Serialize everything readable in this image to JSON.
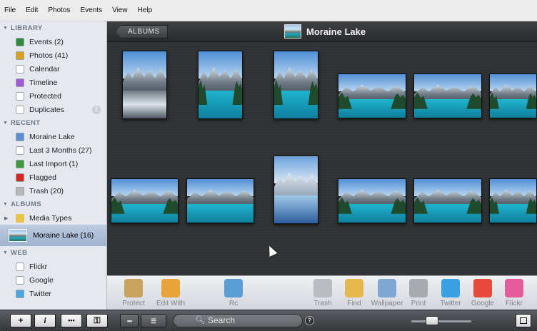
{
  "menu": [
    "File",
    "Edit",
    "Photos",
    "Events",
    "View",
    "Help"
  ],
  "sidebar": {
    "library_header": "LIBRARY",
    "library": [
      {
        "label": "Events (2)",
        "icon": "events-icon",
        "color": "#2f8a3a"
      },
      {
        "label": "Photos (41)",
        "icon": "photos-icon",
        "color": "#d9a21b"
      },
      {
        "label": "Calendar",
        "icon": "calendar-icon",
        "color": "#ffffff"
      },
      {
        "label": "Timeline",
        "icon": "timeline-icon",
        "color": "#a45ad6"
      },
      {
        "label": "Protected",
        "icon": "protected-icon",
        "color": "#ffffff"
      },
      {
        "label": "Duplicates",
        "icon": "duplicates-icon",
        "color": "#ffffff",
        "badge": "2"
      }
    ],
    "recent_header": "RECENT",
    "recent": [
      {
        "label": "Moraine Lake",
        "icon": "album-icon",
        "color": "#5b8fd1"
      },
      {
        "label": "Last 3 Months (27)",
        "icon": "clock-icon",
        "color": "#ffffff"
      },
      {
        "label": "Last Import (1)",
        "icon": "import-icon",
        "color": "#3b9a3b"
      },
      {
        "label": "Flagged",
        "icon": "flag-icon",
        "color": "#d6281e"
      },
      {
        "label": "Trash (20)",
        "icon": "trash-icon",
        "color": "#b8b8b8"
      }
    ],
    "albums_header": "ALBUMS",
    "albums": [
      {
        "label": "Media Types",
        "icon": "folder-icon",
        "color": "#e8c44b"
      }
    ],
    "selected_album": "Moraine Lake (16)",
    "web_header": "WEB",
    "web": [
      {
        "label": "Flickr",
        "icon": "flickr-icon",
        "color": "#ffffff"
      },
      {
        "label": "Google",
        "icon": "google-icon",
        "color": "#ffffff"
      },
      {
        "label": "Twitter",
        "icon": "twitter-icon",
        "color": "#4aa6e0"
      }
    ]
  },
  "header": {
    "back_label": "ALBUMS",
    "album_title": "Moraine Lake"
  },
  "actions": [
    {
      "label": "Protect",
      "icon": "protect-icon",
      "color": "#c9a25b"
    },
    {
      "label": "Edit With",
      "icon": "pencil-icon",
      "color": "#e8a33a"
    },
    {
      "label": "Rc",
      "icon": "rotate-icon",
      "color": "#5a9ed8"
    },
    {
      "label": "Trash",
      "icon": "trash-icon",
      "color": "#b8bbc0"
    },
    {
      "label": "Find",
      "icon": "find-icon",
      "color": "#e5b84e"
    },
    {
      "label": "Wallpaper",
      "icon": "wallpaper-icon",
      "color": "#7ea7d3"
    },
    {
      "label": "Print",
      "icon": "print-icon",
      "color": "#a7aab0"
    },
    {
      "label": "Twitter",
      "icon": "twitter-icon",
      "color": "#3aa0e4"
    },
    {
      "label": "Google",
      "icon": "google-icon",
      "color": "#e84b3c"
    },
    {
      "label": "Flickr",
      "icon": "flickr-icon",
      "color": "#e45c9c"
    }
  ],
  "footer": {
    "add_label": "+",
    "info_label": "i",
    "more_label": "•••",
    "key_label": "⚿",
    "search_placeholder": "Search",
    "help_label": "?"
  }
}
